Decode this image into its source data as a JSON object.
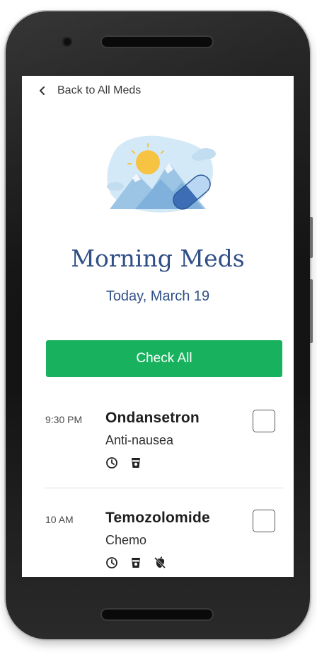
{
  "nav": {
    "back_label": "Back to All Meds"
  },
  "header": {
    "title": "Morning Meds",
    "date": "Today, March 19"
  },
  "actions": {
    "check_all_label": "Check All"
  },
  "medications": [
    {
      "time": "9:30 PM",
      "name": "Ondansetron",
      "purpose": "Anti-nausea",
      "icons": [
        "clock-icon",
        "cup-icon"
      ],
      "checked": false
    },
    {
      "time": "10 AM",
      "name": "Temozolomide",
      "purpose": "Chemo",
      "icons": [
        "clock-icon",
        "cup-icon",
        "no-food-icon"
      ],
      "checked": false
    }
  ],
  "colors": {
    "accent_blue": "#2f4f86",
    "check_all_green": "#18b25e",
    "pill_blue": "#3d6eb5"
  }
}
